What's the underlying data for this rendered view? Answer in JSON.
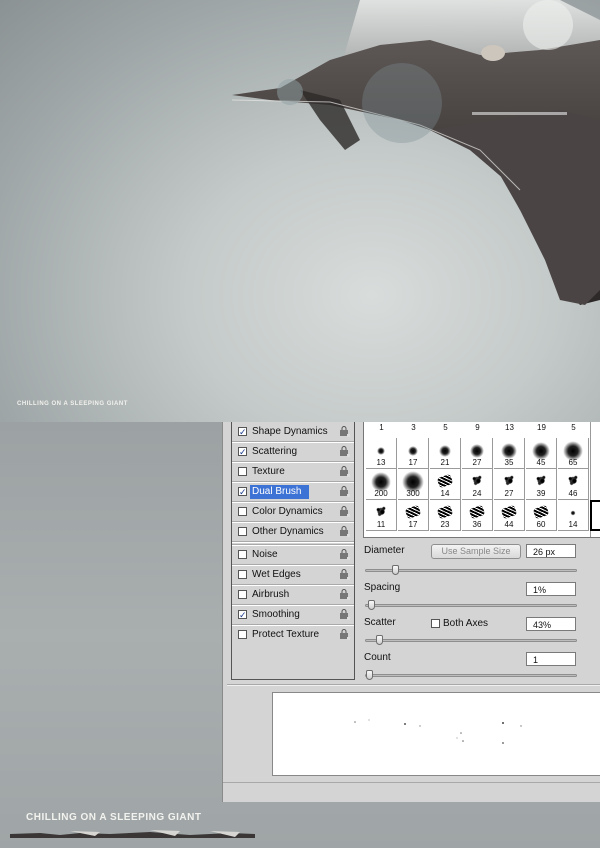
{
  "artwork": {
    "caption_small": "CHILLING ON A SLEEPING GIANT",
    "caption_large": "CHILLING ON A SLEEPING GIANT"
  },
  "brush_panel": {
    "options": [
      {
        "label": "Shape Dynamics",
        "checked": true
      },
      {
        "label": "Scattering",
        "checked": true
      },
      {
        "label": "Texture",
        "checked": false
      },
      {
        "label": "Dual Brush",
        "checked": true,
        "selected": true
      },
      {
        "label": "Color Dynamics",
        "checked": false
      },
      {
        "label": "Other Dynamics",
        "checked": false
      },
      {
        "label": "Noise",
        "checked": false
      },
      {
        "label": "Wet Edges",
        "checked": false
      },
      {
        "label": "Airbrush",
        "checked": false
      },
      {
        "label": "Smoothing",
        "checked": true
      },
      {
        "label": "Protect Texture",
        "checked": false
      }
    ],
    "brush_top_row": [
      "1",
      "3",
      "5",
      "9",
      "13",
      "19",
      "5"
    ],
    "brush_rows": [
      [
        "13",
        "17",
        "21",
        "27",
        "35",
        "45",
        "65"
      ],
      [
        "200",
        "300",
        "14",
        "24",
        "27",
        "39",
        "46"
      ],
      [
        "11",
        "17",
        "23",
        "36",
        "44",
        "60",
        "14"
      ]
    ],
    "diameter": {
      "label": "Diameter",
      "button": "Use Sample Size",
      "value": "26 px",
      "slider": 0.13
    },
    "spacing": {
      "label": "Spacing",
      "value": "1%",
      "slider": 0.01
    },
    "scatter": {
      "label": "Scatter",
      "both_axes_label": "Both Axes",
      "both_axes_checked": false,
      "value": "43%",
      "slider": 0.05
    },
    "count": {
      "label": "Count",
      "value": "1",
      "slider": 0.0
    }
  },
  "colors": {
    "selection": "#3e73d6",
    "panel": "#d4d4d4"
  }
}
